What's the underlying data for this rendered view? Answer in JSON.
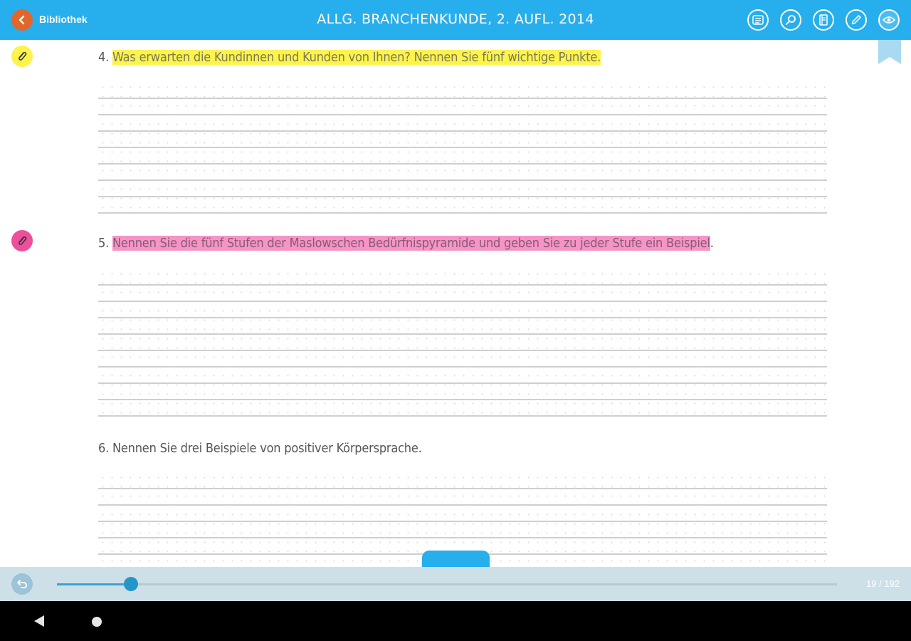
{
  "header": {
    "back_label": "Bibliothek",
    "title": "ALLG. BRANCHENKUNDE, 2. AUFL. 2014",
    "tools": [
      "menu-icon",
      "search-icon",
      "notebook-icon",
      "pen-icon",
      "eye-icon"
    ]
  },
  "questions": [
    {
      "number": "4.",
      "text": "Was erwarten die Kundinnen und Kunden von Ihnen? Nennen Sie fünf wichtige Punkte.",
      "trailing": "",
      "highlight": "#fdf34d"
    },
    {
      "number": "5.",
      "text": "Nennen Sie die fünf Stufen der Maslowschen Bedürfnispyramide und geben Sie zu jeder Stufe ein Beispiel",
      "trailing": ".",
      "highlight": "#f594c7"
    },
    {
      "number": "6.",
      "text": "Nennen Sie drei Beispiele von positiver Körpersprache.",
      "trailing": "",
      "highlight": ""
    }
  ],
  "footer": {
    "page_counter": "19 / 192",
    "progress": 0.095
  },
  "colors": {
    "accent": "#27aeec",
    "back_button": "#e2662a",
    "bottom_bar": "#cde0e8"
  }
}
